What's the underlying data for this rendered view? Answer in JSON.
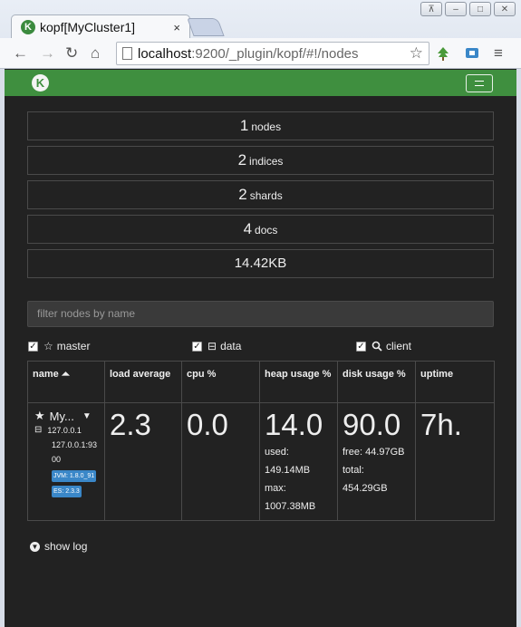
{
  "browser": {
    "tab_title": "kopf[MyCluster1]",
    "tab_close": "×",
    "url_host": "localhost",
    "url_rest": ":9200/_plugin/kopf/#!/nodes"
  },
  "stats": [
    {
      "value": "1",
      "label": "nodes"
    },
    {
      "value": "2",
      "label": "indices"
    },
    {
      "value": "2",
      "label": "shards"
    },
    {
      "value": "4",
      "label": "docs"
    },
    {
      "value": "14.42KB",
      "label": ""
    }
  ],
  "filter": {
    "placeholder": "filter nodes by name"
  },
  "roles": {
    "master": "master",
    "data": "data",
    "client": "client"
  },
  "table": {
    "headers": [
      "name",
      "load average",
      "cpu %",
      "heap usage %",
      "disk usage %",
      "uptime"
    ],
    "row": {
      "name": "My...",
      "ip": "127.0.0.1",
      "address": "127.0.0.1:9300",
      "jvm": "JVM: 1.8.0_91",
      "es": "ES: 2.3.3",
      "load": "2.3",
      "cpu": "0.0",
      "heap": "14.0",
      "heap_used_label": "used:",
      "heap_used": "149.14MB",
      "heap_max_label": "max:",
      "heap_max": "1007.38MB",
      "disk": "90.0",
      "disk_free": "free: 44.97GB",
      "disk_total_label": "total:",
      "disk_total": "454.29GB",
      "uptime": "7h."
    }
  },
  "show_log": "show log",
  "colors": {
    "navbar": "#3f8f3f",
    "background": "#222222",
    "badge": "#3a87c8"
  }
}
